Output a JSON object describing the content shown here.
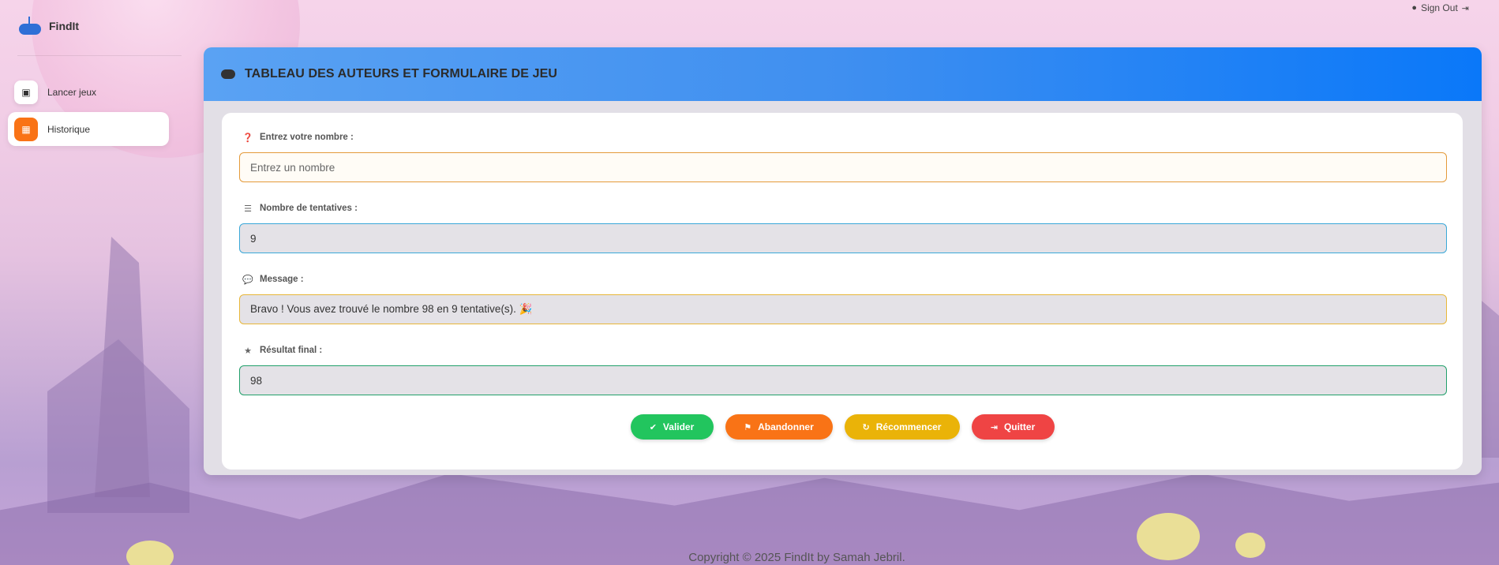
{
  "app": {
    "name": "FindIt"
  },
  "header": {
    "signout_label": "Sign Out",
    "signout_icon": "user-icon"
  },
  "sidebar": {
    "items": [
      {
        "label": "Lancer jeux",
        "icon": "wallet-icon",
        "active": false
      },
      {
        "label": "Historique",
        "icon": "chart-icon",
        "active": true
      }
    ]
  },
  "card": {
    "title": "TABLEAU DES AUTEURS ET FORMULAIRE DE JEU",
    "fields": {
      "number": {
        "label": "Entrez votre nombre :",
        "placeholder": "Entrez un nombre",
        "value": ""
      },
      "attempts": {
        "label": "Nombre de tentatives :",
        "value": "9"
      },
      "message": {
        "label": "Message :",
        "value": "Bravo ! Vous avez trouvé le nombre 98 en 9 tentative(s). 🎉"
      },
      "result": {
        "label": "Résultat final :",
        "value": "98"
      }
    },
    "buttons": {
      "validate": "Valider",
      "abandon": "Abandonner",
      "restart": "Récommencer",
      "quit": "Quitter"
    }
  },
  "footer": {
    "text": "Copyright © 2025 FindIt by Samah Jebril."
  },
  "colors": {
    "header_gradient_start": "#5aa2f3",
    "header_gradient_end": "#0a78f9",
    "validate": "#22c55e",
    "abandon": "#f97316",
    "restart": "#eab308",
    "quit": "#ef4444"
  }
}
